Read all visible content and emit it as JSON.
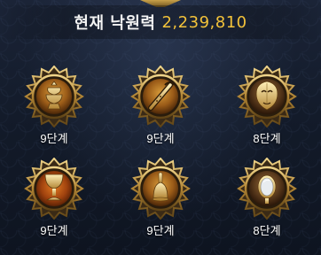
{
  "header": {
    "label": "현재 낙원력",
    "value": "2,239,810"
  },
  "slots": [
    {
      "icon": "incense-burner-icon",
      "level_label": "9단계"
    },
    {
      "icon": "flute-icon",
      "level_label": "9단계"
    },
    {
      "icon": "mask-icon",
      "level_label": "8단계"
    },
    {
      "icon": "chalice-icon",
      "level_label": "9단계"
    },
    {
      "icon": "bell-icon",
      "level_label": "9단계"
    },
    {
      "icon": "mirror-icon",
      "level_label": "8단계"
    }
  ]
}
